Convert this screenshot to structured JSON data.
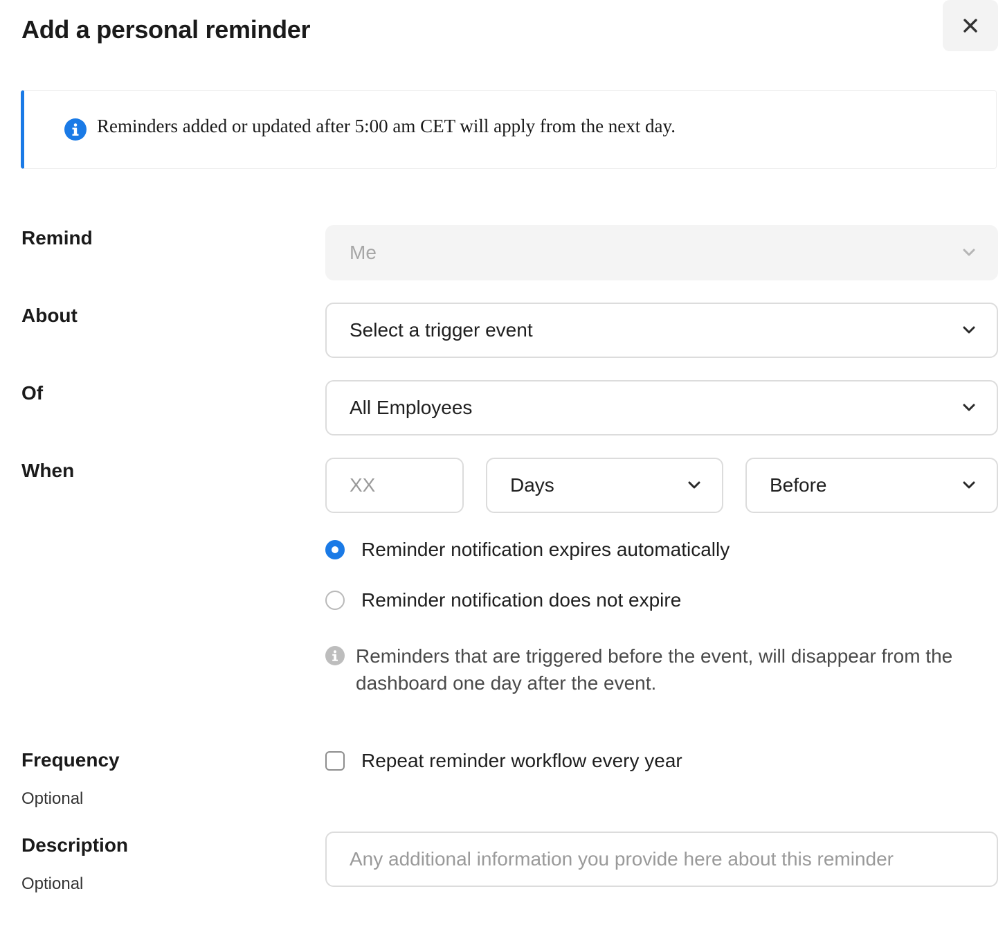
{
  "dialog": {
    "title": "Add a personal reminder",
    "close_icon": "close-icon"
  },
  "banner": {
    "icon": "info-icon",
    "text": "Reminders added or updated after 5:00 am CET will apply from the next day.",
    "accent_color": "#1a7ae6"
  },
  "form": {
    "remind": {
      "label": "Remind",
      "value": "Me",
      "disabled": true
    },
    "about": {
      "label": "About",
      "value": "Select a trigger event"
    },
    "of": {
      "label": "Of",
      "value": "All Employees"
    },
    "when": {
      "label": "When",
      "amount_placeholder": "XX",
      "unit": "Days",
      "direction": "Before",
      "expiry_options": [
        {
          "label": "Reminder notification expires automatically",
          "selected": true
        },
        {
          "label": "Reminder notification does not expire",
          "selected": false
        }
      ],
      "hint": "Reminders that are triggered before the event, will disappear from the dashboard one day after the event."
    },
    "frequency": {
      "label": "Frequency",
      "optional": "Optional",
      "checkbox_label": "Repeat reminder workflow every year",
      "checked": false
    },
    "description": {
      "label": "Description",
      "optional": "Optional",
      "placeholder": "Any additional information you provide here about this reminder"
    }
  }
}
